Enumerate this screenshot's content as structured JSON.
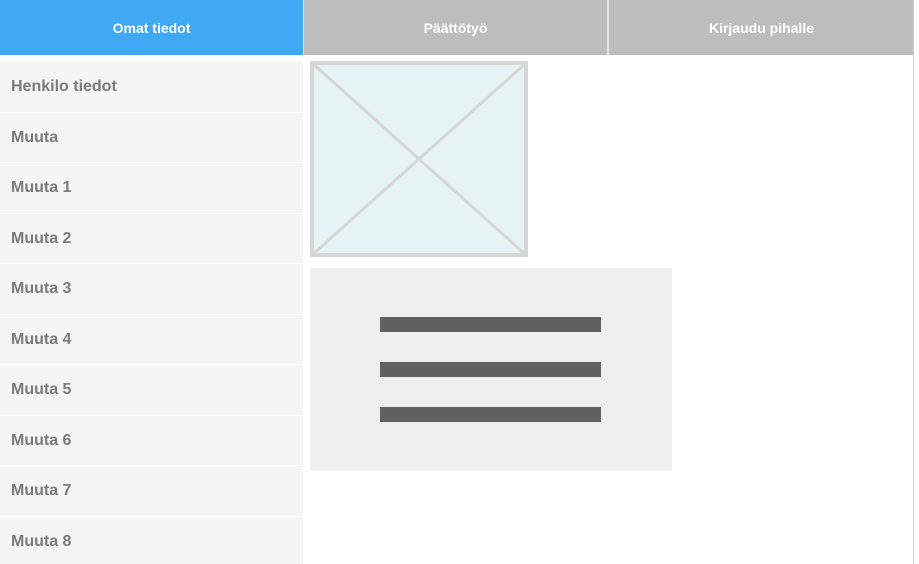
{
  "nav": {
    "tabs": [
      {
        "label": "Omat tiedot",
        "active": true
      },
      {
        "label": "Päättötyö",
        "active": false
      },
      {
        "label": "Kirjaudu pihalle",
        "active": false
      }
    ]
  },
  "sidebar": {
    "items": [
      {
        "label": "Henkilo tiedot"
      },
      {
        "label": "Muuta"
      },
      {
        "label": "Muuta 1"
      },
      {
        "label": "Muuta 2"
      },
      {
        "label": "Muuta 3"
      },
      {
        "label": "Muuta 4"
      },
      {
        "label": "Muuta 5"
      },
      {
        "label": "Muuta 6"
      },
      {
        "label": "Muuta 7"
      },
      {
        "label": "Muuta 8"
      }
    ]
  },
  "content": {
    "image_placeholder_icon": "image-placeholder-icon",
    "text_lines_icon": "text-lines-icon"
  },
  "colors": {
    "active_tab": "#3fa9f5",
    "inactive_tab": "#bdbdbd",
    "sidebar_bg": "#f5f5f5",
    "sidebar_text": "#7a7a7a",
    "placeholder_fill": "#e6f3f5",
    "placeholder_stroke": "#d6d6d6",
    "card_bg": "#efefef",
    "text_line": "#616161"
  }
}
